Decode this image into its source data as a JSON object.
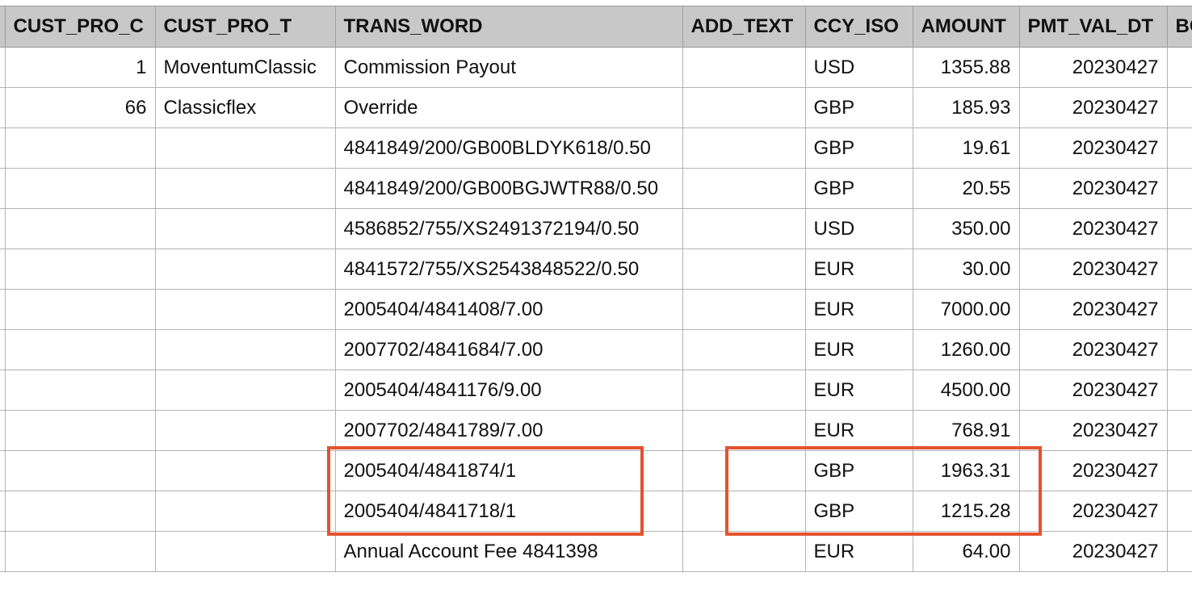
{
  "columns": [
    "CUST_PRO_C",
    "CUST_PRO_T",
    "TRANS_WORD",
    "ADD_TEXT",
    "CCY_ISO",
    "AMOUNT",
    "PMT_VAL_DT",
    "BC"
  ],
  "rows": [
    {
      "cust_pro_c": "1",
      "cust_pro_t": "MoventumClassic",
      "trans_word": "Commission Payout",
      "add_text": "",
      "ccy_iso": "USD",
      "amount": "1355.88",
      "pmt_val_dt": "20230427"
    },
    {
      "cust_pro_c": "66",
      "cust_pro_t": "Classicflex",
      "trans_word": "Override",
      "add_text": "",
      "ccy_iso": "GBP",
      "amount": "185.93",
      "pmt_val_dt": "20230427"
    },
    {
      "cust_pro_c": "",
      "cust_pro_t": "",
      "trans_word": "4841849/200/GB00BLDYK618/0.50",
      "add_text": "",
      "ccy_iso": "GBP",
      "amount": "19.61",
      "pmt_val_dt": "20230427"
    },
    {
      "cust_pro_c": "",
      "cust_pro_t": "",
      "trans_word": "4841849/200/GB00BGJWTR88/0.50",
      "add_text": "",
      "ccy_iso": "GBP",
      "amount": "20.55",
      "pmt_val_dt": "20230427"
    },
    {
      "cust_pro_c": "",
      "cust_pro_t": "",
      "trans_word": "4586852/755/XS2491372194/0.50",
      "add_text": "",
      "ccy_iso": "USD",
      "amount": "350.00",
      "pmt_val_dt": "20230427"
    },
    {
      "cust_pro_c": "",
      "cust_pro_t": "",
      "trans_word": "4841572/755/XS2543848522/0.50",
      "add_text": "",
      "ccy_iso": "EUR",
      "amount": "30.00",
      "pmt_val_dt": "20230427"
    },
    {
      "cust_pro_c": "",
      "cust_pro_t": "",
      "trans_word": "2005404/4841408/7.00",
      "add_text": "",
      "ccy_iso": "EUR",
      "amount": "7000.00",
      "pmt_val_dt": "20230427"
    },
    {
      "cust_pro_c": "",
      "cust_pro_t": "",
      "trans_word": "2007702/4841684/7.00",
      "add_text": "",
      "ccy_iso": "EUR",
      "amount": "1260.00",
      "pmt_val_dt": "20230427"
    },
    {
      "cust_pro_c": "",
      "cust_pro_t": "",
      "trans_word": "2005404/4841176/9.00",
      "add_text": "",
      "ccy_iso": "EUR",
      "amount": "4500.00",
      "pmt_val_dt": "20230427"
    },
    {
      "cust_pro_c": "",
      "cust_pro_t": "",
      "trans_word": "2007702/4841789/7.00",
      "add_text": "",
      "ccy_iso": "EUR",
      "amount": "768.91",
      "pmt_val_dt": "20230427"
    },
    {
      "cust_pro_c": "",
      "cust_pro_t": "",
      "trans_word": "2005404/4841874/1",
      "add_text": "",
      "ccy_iso": "GBP",
      "amount": "1963.31",
      "pmt_val_dt": "20230427"
    },
    {
      "cust_pro_c": "",
      "cust_pro_t": "",
      "trans_word": "2005404/4841718/1",
      "add_text": "",
      "ccy_iso": "GBP",
      "amount": "1215.28",
      "pmt_val_dt": "20230427"
    },
    {
      "cust_pro_c": "",
      "cust_pro_t": "",
      "trans_word": "Annual Account Fee 4841398",
      "add_text": "",
      "ccy_iso": "EUR",
      "amount": "64.00",
      "pmt_val_dt": "20230427"
    }
  ],
  "colors": {
    "header_bg": "#c8c8c8",
    "grid_line": "#b3b3b3",
    "highlight": "#e4532f"
  }
}
